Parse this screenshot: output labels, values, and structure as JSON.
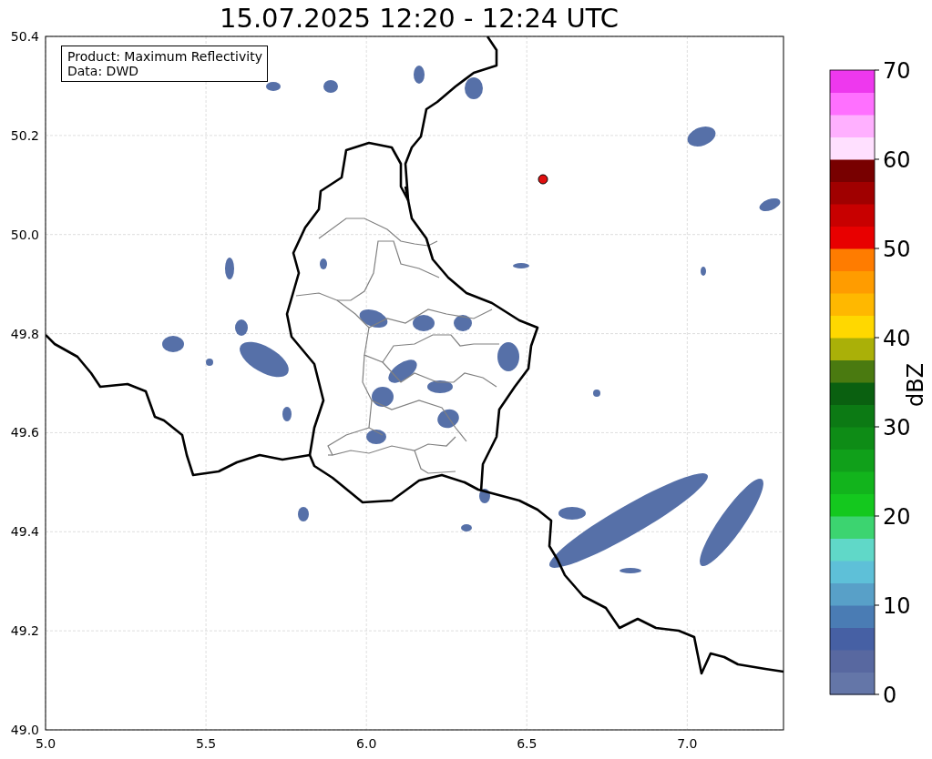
{
  "title": "15.07.2025 12:20 - 12:24 UTC",
  "info_box": [
    "Product: Maximum Reflectivity",
    "Data: DWD"
  ],
  "map": {
    "xticks": [
      "5.0",
      "5.5",
      "6.0",
      "6.5",
      "7.0"
    ],
    "yticks": [
      "50.4",
      "50.2",
      "50.0",
      "49.8",
      "49.6",
      "49.4",
      "49.2",
      "49.0"
    ]
  },
  "colorbar": {
    "label": "dBZ",
    "ticks": [
      "70",
      "60",
      "50",
      "40",
      "30",
      "20",
      "10",
      "0"
    ]
  }
}
